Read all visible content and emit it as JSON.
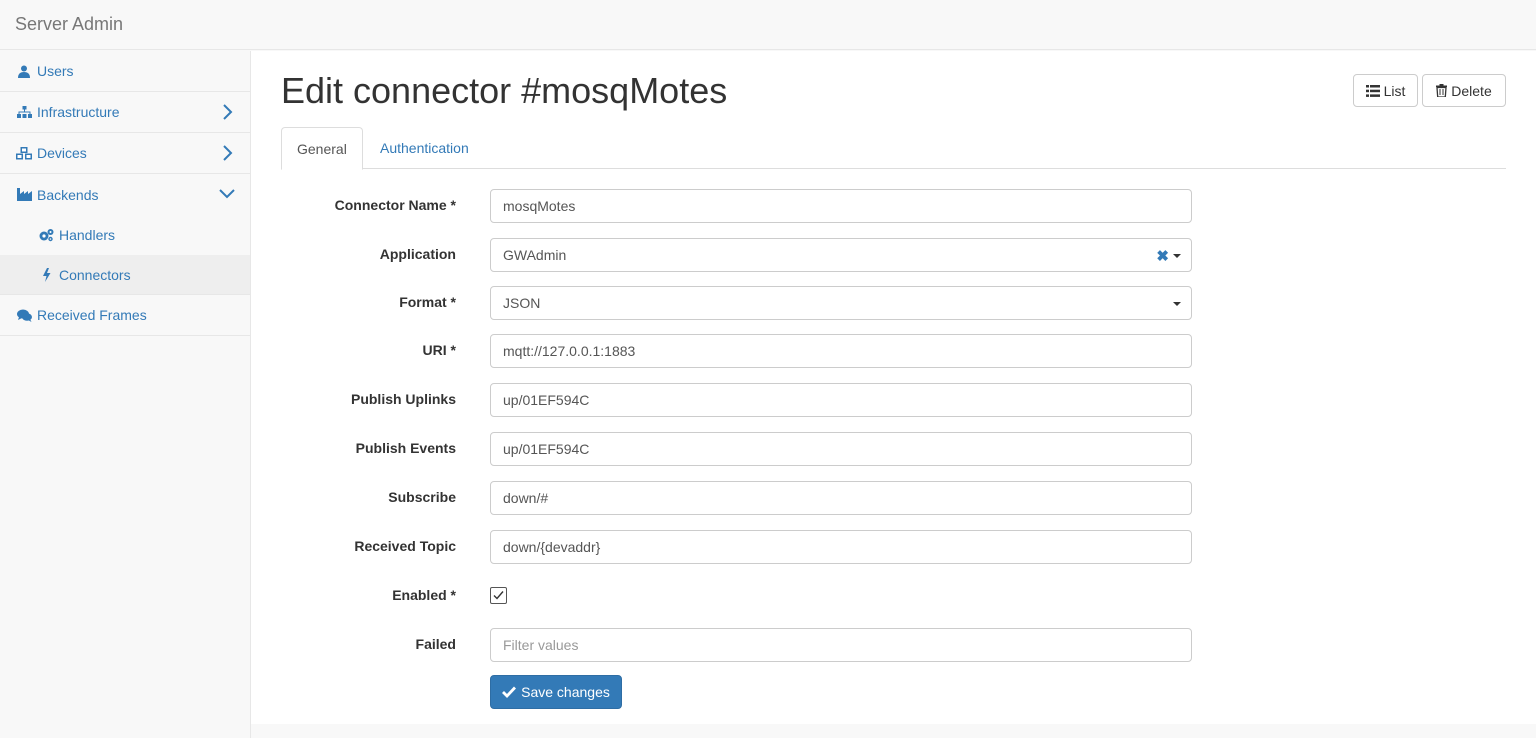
{
  "app": {
    "brand": "Server Admin"
  },
  "sidebar": {
    "items": [
      {
        "label": "Users",
        "icon": "user-icon"
      },
      {
        "label": "Infrastructure",
        "icon": "sitemap-icon",
        "chevron": "chevron-right-icon"
      },
      {
        "label": "Devices",
        "icon": "cubes-icon",
        "chevron": "chevron-right-icon"
      },
      {
        "label": "Backends",
        "icon": "industry-icon",
        "chevron": "chevron-down-icon"
      },
      {
        "label": "Handlers",
        "icon": "cogs-icon"
      },
      {
        "label": "Connectors",
        "icon": "bolt-icon",
        "active": true
      },
      {
        "label": "Received Frames",
        "icon": "comments-icon"
      }
    ]
  },
  "header": {
    "title": "Edit connector #mosqMotes",
    "list_label": "List",
    "delete_label": "Delete"
  },
  "tabs": [
    {
      "label": "General",
      "active": true
    },
    {
      "label": "Authentication",
      "active": false
    }
  ],
  "form": {
    "connector_name": {
      "label": "Connector Name *",
      "value": "mosqMotes"
    },
    "application": {
      "label": "Application",
      "value": "GWAdmin"
    },
    "format": {
      "label": "Format *",
      "value": "JSON"
    },
    "uri": {
      "label": "URI *",
      "value": "mqtt://127.0.0.1:1883"
    },
    "publish_uplinks": {
      "label": "Publish Uplinks",
      "value": "up/01EF594C"
    },
    "publish_events": {
      "label": "Publish Events",
      "value": "up/01EF594C"
    },
    "subscribe": {
      "label": "Subscribe",
      "value": "down/#"
    },
    "received_topic": {
      "label": "Received Topic",
      "value": "down/{devaddr}"
    },
    "enabled": {
      "label": "Enabled *",
      "checked": true
    },
    "failed": {
      "label": "Failed",
      "placeholder": "Filter values"
    },
    "save_label": "Save changes"
  },
  "colors": {
    "link": "#337ab7",
    "primary": "#337ab7"
  }
}
